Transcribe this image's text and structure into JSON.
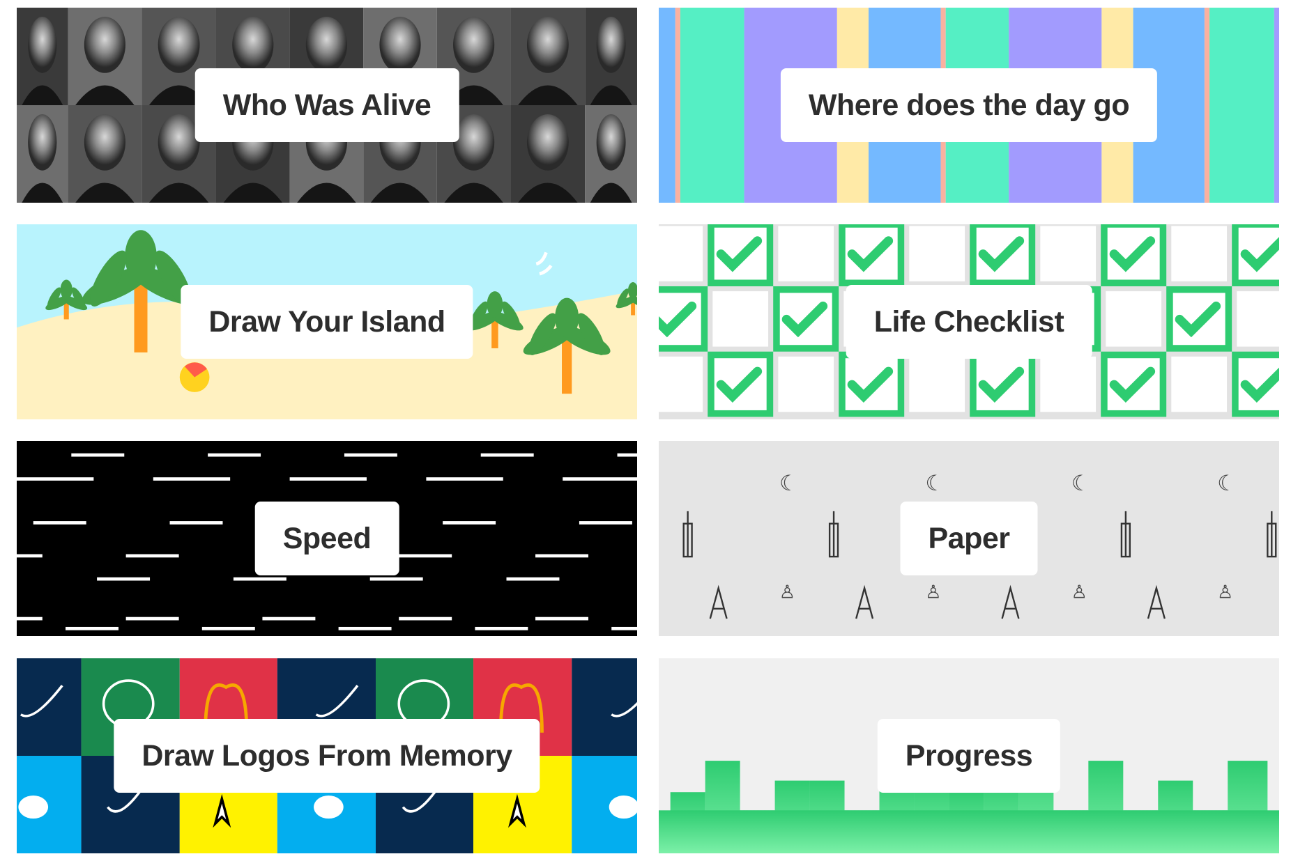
{
  "cards": [
    {
      "title": "Who Was Alive",
      "pattern": "historical-portraits"
    },
    {
      "title": "Where does the day go",
      "pattern": "colored-stripes",
      "colors": [
        "#74b9ff",
        "#fab1a0",
        "#55efc4",
        "#a29bfe",
        "#ffeaa7"
      ]
    },
    {
      "title": "Draw Your Island",
      "pattern": "beach-palms",
      "colors": [
        "#b8f3fd",
        "#fff1c1",
        "#43a047",
        "#ff9a1f"
      ]
    },
    {
      "title": "Life Checklist",
      "pattern": "checkbox-grid",
      "colors": [
        "#2ecc71",
        "#e2e2e2",
        "#ffffff"
      ]
    },
    {
      "title": "Speed",
      "pattern": "motion-dashes",
      "colors": [
        "#000000",
        "#ffffff"
      ]
    },
    {
      "title": "Paper",
      "pattern": "landmark-icons",
      "colors": [
        "#e5e5e5",
        "#333333"
      ]
    },
    {
      "title": "Draw Logos From Memory",
      "pattern": "logo-sketches",
      "colors": [
        "#072a4f",
        "#1a8a4e",
        "#e03247",
        "#03aeef",
        "#fff200"
      ]
    },
    {
      "title": "Progress",
      "pattern": "bar-skyline",
      "colors": [
        "#f0f0f0",
        "#2ecc71",
        "#7cf0a8"
      ]
    }
  ]
}
